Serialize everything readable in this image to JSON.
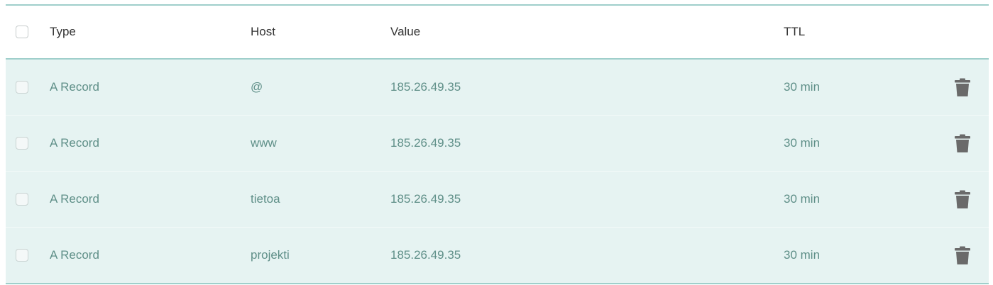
{
  "columns": {
    "type": "Type",
    "host": "Host",
    "value": "Value",
    "ttl": "TTL"
  },
  "records": [
    {
      "type": "A Record",
      "host": "@",
      "value": "185.26.49.35",
      "ttl": "30 min"
    },
    {
      "type": "A Record",
      "host": "www",
      "value": "185.26.49.35",
      "ttl": "30 min"
    },
    {
      "type": "A Record",
      "host": "tietoa",
      "value": "185.26.49.35",
      "ttl": "30 min"
    },
    {
      "type": "A Record",
      "host": "projekti",
      "value": "185.26.49.35",
      "ttl": "30 min"
    }
  ],
  "icons": {
    "row_action": "trash-icon",
    "select": "checkbox"
  },
  "colors": {
    "accent_border": "#9fcfcb",
    "row_background": "#e6f3f2",
    "row_text": "#5f8f88",
    "icon": "#6a6a6a"
  }
}
